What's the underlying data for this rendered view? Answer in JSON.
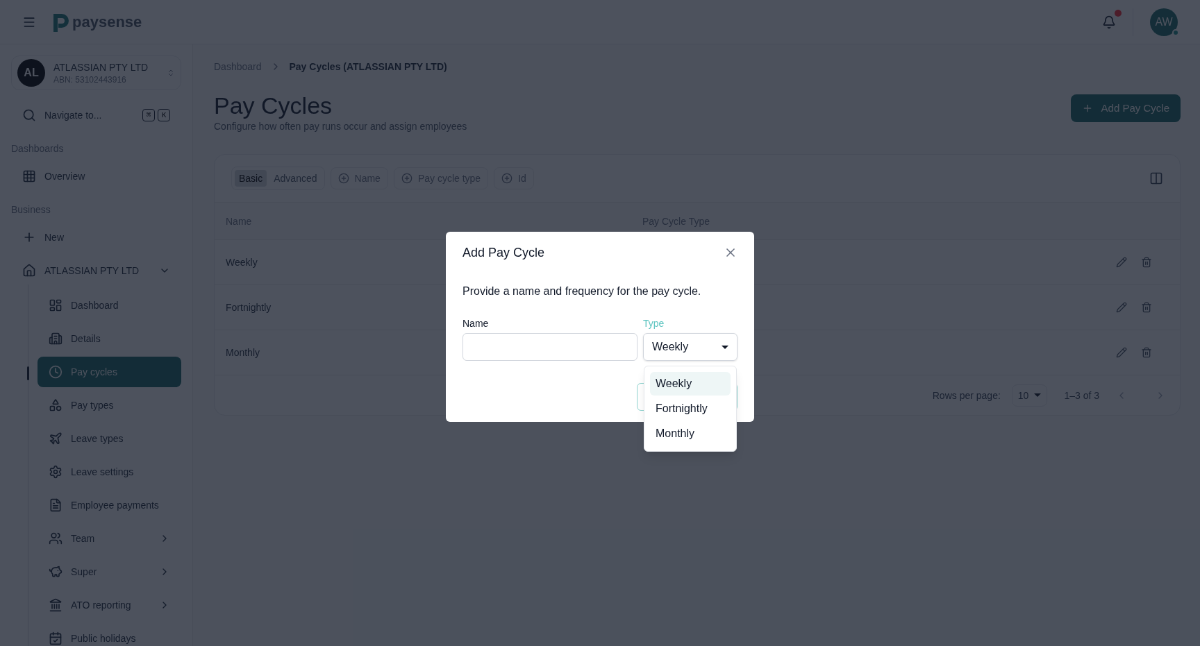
{
  "header": {
    "logo_text": "paysense",
    "notifications": {
      "unread": true
    },
    "user": {
      "initials": "AW",
      "online": true
    }
  },
  "sidebar": {
    "company": {
      "initials": "AL",
      "name": "ATLASSIAN PTY LTD",
      "abn": "ABN: 53102443916"
    },
    "search": {
      "placeholder": "Navigate to...",
      "keys": [
        "⌘",
        "K"
      ]
    },
    "sections": [
      {
        "label": "Dashboards",
        "items": [
          {
            "label": "Overview",
            "kind": "link"
          }
        ]
      },
      {
        "label": "Business",
        "items": [
          {
            "label": "New",
            "kind": "link"
          },
          {
            "label": "ATLASSIAN PTY LTD",
            "kind": "group",
            "expanded": true,
            "children": [
              {
                "label": "Dashboard",
                "selected": false,
                "has_submenu": false
              },
              {
                "label": "Details",
                "selected": false,
                "has_submenu": false
              },
              {
                "label": "Pay cycles",
                "selected": true,
                "has_submenu": false
              },
              {
                "label": "Pay types",
                "selected": false,
                "has_submenu": false
              },
              {
                "label": "Leave types",
                "selected": false,
                "has_submenu": false
              },
              {
                "label": "Leave settings",
                "selected": false,
                "has_submenu": false
              },
              {
                "label": "Employee payments",
                "selected": false,
                "has_submenu": false
              },
              {
                "label": "Team",
                "selected": false,
                "has_submenu": true
              },
              {
                "label": "Super",
                "selected": false,
                "has_submenu": true
              },
              {
                "label": "ATO reporting",
                "selected": false,
                "has_submenu": true
              },
              {
                "label": "Public holidays",
                "selected": false,
                "has_submenu": false
              }
            ]
          }
        ]
      }
    ]
  },
  "breadcrumb": [
    "Dashboard",
    "Pay Cycles (ATLASSIAN PTY LTD)"
  ],
  "page": {
    "title": "Pay Cycles",
    "subtitle": "Configure how often pay runs occur and assign employees",
    "add_button": "Add Pay Cycle"
  },
  "filters": {
    "modes": [
      {
        "label": "Basic",
        "selected": true
      },
      {
        "label": "Advanced",
        "selected": false
      }
    ],
    "chips": [
      "Name",
      "Pay cycle type",
      "Id"
    ]
  },
  "table": {
    "columns": [
      "Name",
      "Pay Cycle Type"
    ],
    "rows": [
      {
        "name": "Weekly"
      },
      {
        "name": "Fortnightly"
      },
      {
        "name": "Monthly"
      }
    ],
    "pagination": {
      "rows_per_page_label": "Rows per page:",
      "rows_per_page": "10",
      "range": "1–3 of 3"
    }
  },
  "dialog": {
    "title": "Add Pay Cycle",
    "description": "Provide a name and frequency for the pay cycle.",
    "name_field": {
      "label": "Name"
    },
    "type_field": {
      "label": "Type",
      "value": "Weekly",
      "open": true,
      "options": [
        {
          "label": "Weekly",
          "selected": true
        },
        {
          "label": "Fortnightly",
          "selected": false
        },
        {
          "label": "Monthly",
          "selected": false
        }
      ]
    }
  }
}
